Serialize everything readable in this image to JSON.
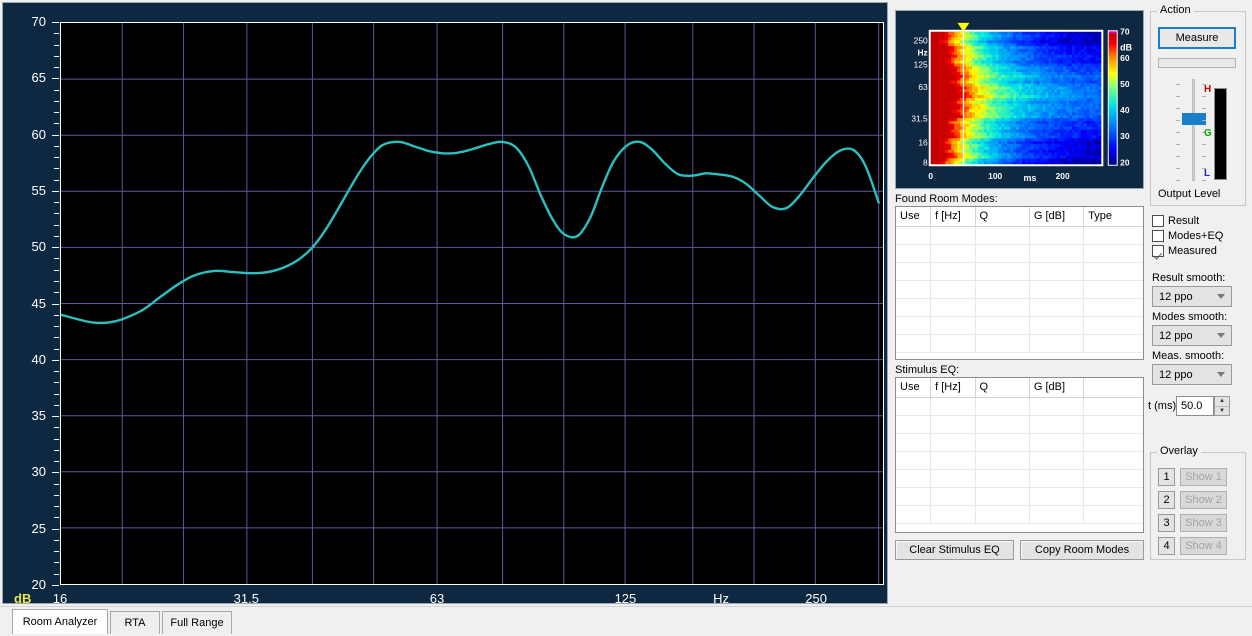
{
  "chart_data": {
    "type": "line",
    "title": "",
    "xlabel": "Hz",
    "ylabel": "dB",
    "xscale": "log",
    "xlim": [
      16,
      320
    ],
    "ylim": [
      20,
      70
    ],
    "ytick_step": 5,
    "grid": true,
    "legend": "none",
    "line_color": "#2bbfbf",
    "background": "#000000",
    "gridline_color": "#5a5a9c",
    "xticks": [
      "16",
      "31.5",
      "63",
      "125",
      "Hz",
      "250"
    ],
    "xtick_values": [
      16,
      31.5,
      63,
      125,
      177,
      250
    ],
    "yticks": [
      "20",
      "25",
      "30",
      "35",
      "40",
      "45",
      "50",
      "55",
      "60",
      "65",
      "70"
    ],
    "series": [
      {
        "name": "Measured",
        "x": [
          16.0,
          17.0,
          18.0,
          19.0,
          20.0,
          21.5,
          23.0,
          24.5,
          26.0,
          28.0,
          30.0,
          32.0,
          34.0,
          36.0,
          38.0,
          40.0,
          42.0,
          44.0,
          46.0,
          48.0,
          50.0,
          52.0,
          55.0,
          58.0,
          61.0,
          64.0,
          67.0,
          70.0,
          73.0,
          76.0,
          80.0,
          84.0,
          88.0,
          92.0,
          96.0,
          100.0,
          105.0,
          110.0,
          115.0,
          120.0,
          126.0,
          132.0,
          138.0,
          145.0,
          152.0,
          160.0,
          168.0,
          176.0,
          185.0,
          194.0,
          204.0,
          214.0,
          225.0,
          236.0,
          248.0,
          260.0,
          273.0,
          287.0,
          300.0,
          315.0
        ],
        "y": [
          44.0,
          43.6,
          43.3,
          43.3,
          43.6,
          44.4,
          45.6,
          46.7,
          47.5,
          47.9,
          47.8,
          47.7,
          47.8,
          48.2,
          48.9,
          50.0,
          51.6,
          53.5,
          55.4,
          57.1,
          58.4,
          59.2,
          59.4,
          59.0,
          58.6,
          58.4,
          58.4,
          58.6,
          58.9,
          59.2,
          59.4,
          58.9,
          57.2,
          54.6,
          52.5,
          51.2,
          51.0,
          52.6,
          55.4,
          57.7,
          59.1,
          59.4,
          58.7,
          57.4,
          56.5,
          56.4,
          56.6,
          56.5,
          56.3,
          55.7,
          54.6,
          53.6,
          53.5,
          54.6,
          56.2,
          57.6,
          58.6,
          58.7,
          57.3,
          54.0
        ]
      }
    ]
  },
  "graph": {
    "db_tag": "dB",
    "y_axis_labels": [
      "70",
      "65",
      "60",
      "55",
      "50",
      "45",
      "40",
      "35",
      "30",
      "25",
      "20"
    ],
    "x_axis_labels": [
      "16",
      "31.5",
      "63",
      "125",
      "Hz",
      "250"
    ]
  },
  "spectrogram": {
    "type": "heatmap",
    "xlabel": "ms",
    "ylabel": "Hz",
    "y_labels": [
      "250",
      "Hz",
      "125",
      "63",
      "31.5",
      "16",
      "8"
    ],
    "x_labels": [
      "0",
      "100",
      "ms",
      "200"
    ],
    "colorbar_label": "dB",
    "colorbar_labels": [
      "70",
      "60",
      "50",
      "40",
      "30",
      "20"
    ],
    "colorbar_min": 20,
    "colorbar_max": 70,
    "cursor_time_ms": 50,
    "cursor_color": "#ffff00"
  },
  "found_room_modes": {
    "title": "Found Room Modes:",
    "columns": [
      "Use",
      "f [Hz]",
      "Q",
      "G [dB]",
      "Type"
    ],
    "rows": []
  },
  "stimulus_eq": {
    "title": "Stimulus EQ:",
    "columns": [
      "Use",
      "f [Hz]",
      "Q",
      "G [dB]",
      ""
    ],
    "rows": []
  },
  "buttons": {
    "clear_stimulus_eq": "Clear Stimulus EQ",
    "copy_room_modes": "Copy Room Modes"
  },
  "action": {
    "title": "Action",
    "measure_label": "Measure",
    "output_level_label": "Output Level",
    "marker_high": "H",
    "marker_gain": "G",
    "marker_low": "L",
    "marker_high_color": "#cc0000",
    "marker_gain_color": "#00aa00",
    "marker_low_color": "#2222cc",
    "accent_color": "#1a7ecb"
  },
  "display_options": {
    "checkboxes": [
      {
        "label": "Result",
        "checked": false
      },
      {
        "label": "Modes+EQ",
        "checked": false
      },
      {
        "label": "Measured",
        "checked": true
      }
    ],
    "result_smooth_label": "Result smooth:",
    "result_smooth_value": "12 ppo",
    "modes_smooth_label": "Modes smooth:",
    "modes_smooth_value": "12 ppo",
    "meas_smooth_label": "Meas. smooth:",
    "meas_smooth_value": "12 ppo",
    "t_ms_label": "t (ms)",
    "t_ms_value": "50.0"
  },
  "overlay": {
    "title": "Overlay",
    "items": [
      {
        "number": "1",
        "label": "Show 1"
      },
      {
        "number": "2",
        "label": "Show 2"
      },
      {
        "number": "3",
        "label": "Show 3"
      },
      {
        "number": "4",
        "label": "Show 4"
      }
    ]
  },
  "tabs": [
    {
      "label": "Room Analyzer",
      "active": true
    },
    {
      "label": "RTA",
      "active": false
    },
    {
      "label": "Full Range",
      "active": false
    }
  ]
}
